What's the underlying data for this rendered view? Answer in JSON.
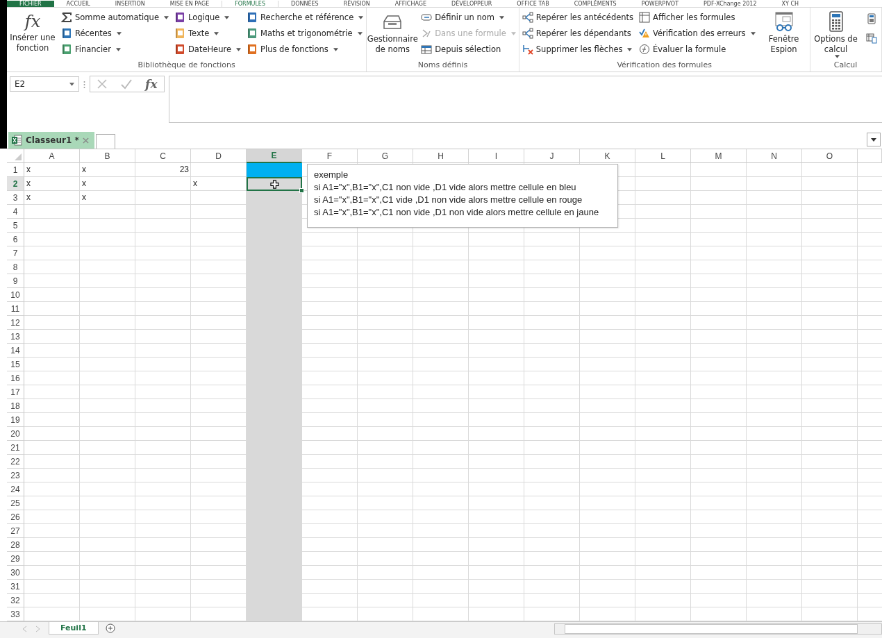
{
  "ribbon_tabs": [
    {
      "label": "FICHIER",
      "selected": false,
      "kind": "file"
    },
    {
      "label": "ACCUEIL",
      "selected": false
    },
    {
      "label": "INSERTION",
      "selected": false
    },
    {
      "label": "MISE EN PAGE",
      "selected": false
    },
    {
      "label": "FORMULES",
      "selected": true
    },
    {
      "label": "DONNÉES",
      "selected": false
    },
    {
      "label": "RÉVISION",
      "selected": false
    },
    {
      "label": "AFFICHAGE",
      "selected": false
    },
    {
      "label": "DÉVELOPPEUR",
      "selected": false
    },
    {
      "label": "OFFICE TAB",
      "selected": false
    },
    {
      "label": "COMPLÉMENTS",
      "selected": false
    },
    {
      "label": "POWERPIVOT",
      "selected": false
    },
    {
      "label": "PDF-XChange 2012",
      "selected": false
    },
    {
      "label": "XY CH",
      "selected": false
    }
  ],
  "ribbon_groups": [
    {
      "label": "Bibliothèque de fonctions",
      "items": [
        {
          "kind": "large",
          "label": "Insérer une fonction",
          "symbol": "fx",
          "dropdown": false
        },
        {
          "kind": "column",
          "buttons": [
            {
              "label": "Somme automatique",
              "dropdown": true,
              "disabled": false
            },
            {
              "label": "Récentes",
              "dropdown": true,
              "disabled": false
            },
            {
              "label": "Financier",
              "dropdown": true,
              "disabled": false
            }
          ]
        },
        {
          "kind": "column",
          "buttons": [
            {
              "label": "Logique",
              "dropdown": true,
              "disabled": false
            },
            {
              "label": "Texte",
              "dropdown": true,
              "disabled": false
            },
            {
              "label": "DateHeure",
              "dropdown": true,
              "disabled": false
            }
          ]
        },
        {
          "kind": "column",
          "buttons": [
            {
              "label": "Recherche et référence",
              "dropdown": true,
              "disabled": false
            },
            {
              "label": "Maths et trigonométrie",
              "dropdown": true,
              "disabled": false
            },
            {
              "label": "Plus de fonctions",
              "dropdown": true,
              "disabled": false
            }
          ]
        }
      ]
    },
    {
      "label": "Noms définis",
      "items": [
        {
          "kind": "large",
          "label": "Gestionnaire de noms",
          "dropdown": false
        },
        {
          "kind": "column",
          "buttons": [
            {
              "label": "Définir un nom",
              "dropdown": true,
              "disabled": false
            },
            {
              "label": "Dans une formule",
              "dropdown": true,
              "disabled": true
            },
            {
              "label": "Depuis sélection",
              "dropdown": false,
              "disabled": false
            }
          ]
        }
      ]
    },
    {
      "label": "Vérification des formules",
      "items": [
        {
          "kind": "column",
          "buttons": [
            {
              "label": "Repérer les antécédents",
              "dropdown": false,
              "disabled": false
            },
            {
              "label": "Repérer les dépendants",
              "dropdown": false,
              "disabled": false
            },
            {
              "label": "Supprimer les flèches",
              "dropdown": true,
              "disabled": false
            }
          ]
        },
        {
          "kind": "column",
          "buttons": [
            {
              "label": "Afficher les formules",
              "dropdown": false,
              "disabled": false
            },
            {
              "label": "Vérification des erreurs",
              "dropdown": true,
              "disabled": false
            },
            {
              "label": "Évaluer la formule",
              "dropdown": false,
              "disabled": false
            }
          ]
        },
        {
          "kind": "large",
          "label": "Fenêtre Espion",
          "dropdown": false
        }
      ]
    },
    {
      "label": "Calcul",
      "items": [
        {
          "kind": "large",
          "label": "Options de calcul",
          "dropdown": true
        },
        {
          "kind": "icon_column",
          "buttons": [
            {
              "disabled": false
            },
            {
              "disabled": false
            }
          ]
        }
      ]
    }
  ],
  "formula_bar": {
    "name_box": "E2",
    "function_symbol": "fx"
  },
  "workbook_tabs": [
    {
      "label": "Classeur1 *",
      "selected": true
    }
  ],
  "columns": [
    {
      "label": "A",
      "selected": false
    },
    {
      "label": "B",
      "selected": false
    },
    {
      "label": "C",
      "selected": false
    },
    {
      "label": "D",
      "selected": false
    },
    {
      "label": "E",
      "selected": true
    },
    {
      "label": "F",
      "selected": false
    },
    {
      "label": "G",
      "selected": false
    },
    {
      "label": "H",
      "selected": false
    },
    {
      "label": "I",
      "selected": false
    },
    {
      "label": "J",
      "selected": false
    },
    {
      "label": "K",
      "selected": false
    },
    {
      "label": "L",
      "selected": false
    },
    {
      "label": "M",
      "selected": false
    },
    {
      "label": "N",
      "selected": false
    },
    {
      "label": "O",
      "selected": false
    }
  ],
  "rows": [
    {
      "number": "1",
      "selected": false,
      "cells": [
        {
          "value": "x"
        },
        {
          "value": "x"
        },
        {
          "value": "23",
          "kind": "number"
        },
        {},
        {
          "color": "#00b0f0"
        }
      ]
    },
    {
      "number": "2",
      "selected": true,
      "cells": [
        {
          "value": "x"
        },
        {
          "value": "x"
        },
        {},
        {
          "value": "x"
        }
      ]
    },
    {
      "number": "3",
      "selected": false,
      "cells": [
        {
          "value": "x"
        },
        {
          "value": "x"
        }
      ]
    },
    {
      "number": "4",
      "selected": false
    },
    {
      "number": "5",
      "selected": false
    },
    {
      "number": "6",
      "selected": false
    },
    {
      "number": "7",
      "selected": false
    },
    {
      "number": "8",
      "selected": false
    },
    {
      "number": "9",
      "selected": false
    },
    {
      "number": "10",
      "selected": false
    },
    {
      "number": "11",
      "selected": false
    },
    {
      "number": "12",
      "selected": false
    },
    {
      "number": "13",
      "selected": false
    },
    {
      "number": "14",
      "selected": false
    },
    {
      "number": "15",
      "selected": false
    },
    {
      "number": "16",
      "selected": false
    },
    {
      "number": "17",
      "selected": false
    },
    {
      "number": "18",
      "selected": false
    },
    {
      "number": "19",
      "selected": false
    },
    {
      "number": "20",
      "selected": false
    },
    {
      "number": "21",
      "selected": false
    },
    {
      "number": "22",
      "selected": false
    },
    {
      "number": "23",
      "selected": false
    },
    {
      "number": "24",
      "selected": false
    },
    {
      "number": "25",
      "selected": false
    },
    {
      "number": "26",
      "selected": false
    },
    {
      "number": "27",
      "selected": false
    },
    {
      "number": "28",
      "selected": false
    },
    {
      "number": "29",
      "selected": false
    },
    {
      "number": "30",
      "selected": false
    },
    {
      "number": "31",
      "selected": false
    },
    {
      "number": "32",
      "selected": false
    },
    {
      "number": "33",
      "selected": false
    }
  ],
  "comment": {
    "lines": [
      "exemple",
      "si A1=\"x\",B1=\"x\",C1 non vide ,D1 vide alors mettre cellule en bleu",
      "si A1=\"x\",B1=\"x\",C1 vide ,D1 non vide alors mettre cellule en rouge",
      "si A1=\"x\",B1=\"x\",C1 non vide ,D1 non vide alors mettre cellule en jaune"
    ]
  },
  "sheet_tabs": [
    {
      "label": "Feuil1",
      "selected": true
    }
  ]
}
